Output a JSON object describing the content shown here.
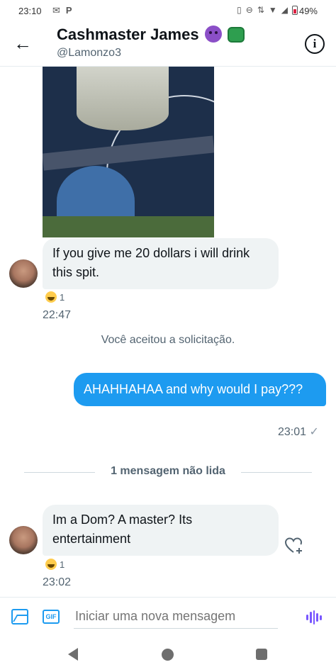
{
  "status_bar": {
    "time": "23:10",
    "battery": "49%"
  },
  "header": {
    "title": "Cashmaster James",
    "handle": "@Lamonzo3",
    "info_symbol": "i",
    "back_symbol": "←"
  },
  "messages": [
    {
      "direction": "in",
      "text": "If you give me 20 dollars i will drink this spit.",
      "reaction_count": "1",
      "time": "22:47"
    },
    {
      "direction": "system",
      "text": "Você aceitou a solicitação."
    },
    {
      "direction": "out",
      "text": "AHAHHAHAA and why would I pay???",
      "time": "23:01",
      "read_check": "✓"
    },
    {
      "direction": "divider",
      "text": "1 mensagem não lida"
    },
    {
      "direction": "in",
      "text": "Im a Dom? A master? Its entertainment",
      "reaction_count": "1",
      "time": "23:02"
    }
  ],
  "composer": {
    "placeholder": "Iniciar uma nova mensagem",
    "gif_label": "GIF"
  },
  "colors": {
    "accent": "#1d9bf0",
    "incoming_bubble": "#eff3f4",
    "secondary_text": "#536471",
    "voice_icon": "#7856ff"
  },
  "icons": {
    "back": "arrow-left-icon",
    "info": "info-icon",
    "image": "image-icon",
    "gif": "gif-icon",
    "voice": "voice-wave-icon",
    "reaction": "laughing-emoji-icon",
    "add_reaction": "heart-plus-icon"
  }
}
